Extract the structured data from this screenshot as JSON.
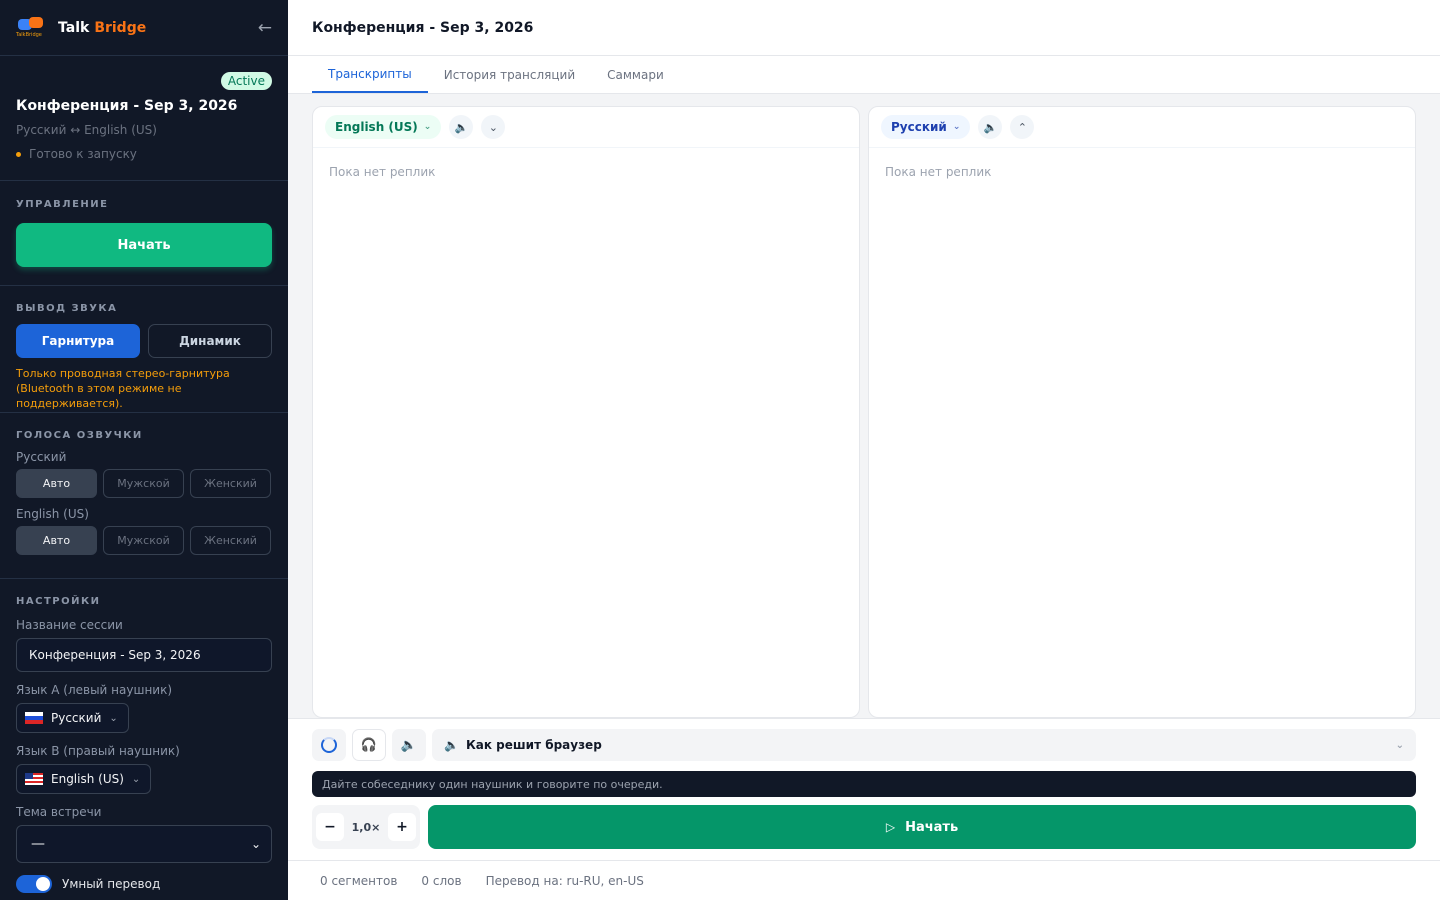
{
  "app": {
    "name_part1": "Talk",
    "name_part2": "Bridge",
    "logo_text": "TalkBridge"
  },
  "sidebar": {
    "session": {
      "badge": "Active",
      "title": "Конференция - Sep 3, 2026",
      "langs": "Русский ↔ English (US)",
      "status": "Готово к запуску"
    },
    "control": {
      "heading": "УПРАВЛЕНИЕ",
      "start_label": "Начать"
    },
    "audio": {
      "heading": "ВЫВОД ЗВУКА",
      "headset_label": "Гарнитура",
      "speaker_label": "Динамик",
      "warning": "Только проводная стерео-гарнитура (Bluetooth в этом режиме не поддерживается)."
    },
    "voices": {
      "heading": "ГОЛОСА ОЗВУЧКИ",
      "groups": [
        {
          "lang": "Русский",
          "options": [
            "Авто",
            "Мужской",
            "Женский"
          ]
        },
        {
          "lang": "English (US)",
          "options": [
            "Авто",
            "Мужской",
            "Женский"
          ]
        }
      ]
    },
    "settings": {
      "heading": "НАСТРОЙКИ",
      "session_name_label": "Название сессии",
      "session_name_value": "Конференция - Sep 3, 2026",
      "lang_a_label": "Язык A (левый наушник)",
      "lang_a_value": "Русский",
      "lang_b_label": "Язык B (правый наушник)",
      "lang_b_value": "English (US)",
      "topic_label": "Тема встречи",
      "topic_value": "—",
      "smart_label": "Умный перевод"
    }
  },
  "main": {
    "title": "Конференция - Sep 3, 2026",
    "tabs": [
      "Транскрипты",
      "История трансляций",
      "Саммари"
    ],
    "left_panel": {
      "lang": "English (US)",
      "empty": "Пока нет реплик"
    },
    "right_panel": {
      "lang": "Русский",
      "empty": "Пока нет реплик"
    },
    "mode_label": "Как решит браузер",
    "hint": "Дайте собеседнику один наушник и говорите по очереди.",
    "speed": "1,0×",
    "start_label": "Начать",
    "footer": {
      "segments": "0 сегментов",
      "words": "0 слов",
      "translation": "Перевод на: ru-RU, en-US"
    }
  },
  "colors": {
    "sidebar_bg": "#111827",
    "accent_green": "#10b981",
    "accent_blue": "#1d64d8",
    "brand_orange": "#f97316"
  }
}
